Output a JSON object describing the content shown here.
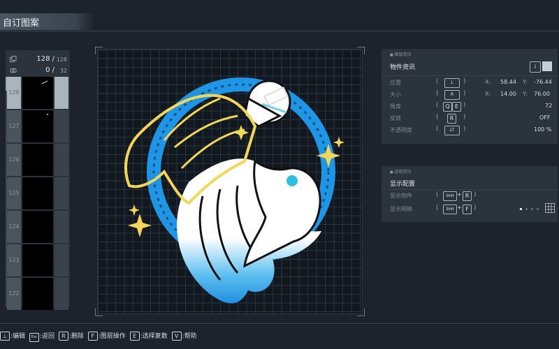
{
  "title": "自订图案",
  "layer_counter": {
    "used": "128 /",
    "max": "128"
  },
  "group_counter": {
    "used": "0 /",
    "max": "32"
  },
  "layers": [
    "128",
    "127",
    "126",
    "125",
    "124",
    "123",
    "122"
  ],
  "object_info": {
    "tag": "图层资讯",
    "title": "物件资讯",
    "position": {
      "label": "位置",
      "x_label": "X:",
      "x": "58.44",
      "y_label": "Y:",
      "y": "-76.44"
    },
    "size": {
      "label": "大小",
      "x_label": "X:",
      "x": "14.00",
      "y_label": "Y:",
      "y": "76.00"
    },
    "angle": {
      "label": "角度",
      "keys": [
        "Q",
        "E"
      ],
      "value": "72"
    },
    "flip": {
      "label": "反转",
      "key": "R",
      "value": "OFF"
    },
    "opacity": {
      "label": "不透明度",
      "value": "100 %"
    }
  },
  "display": {
    "tag": "选项资讯",
    "title": "显示配置",
    "show_objects": {
      "label": "显示物件",
      "key1": "Shift",
      "key2": "R"
    },
    "show_grid": {
      "label": "显示网格",
      "key1": "Shift",
      "key2": "F"
    }
  },
  "hints": [
    {
      "key": "",
      "label": ":编辑"
    },
    {
      "key": "Esc",
      "label": ":返回"
    },
    {
      "key": "R",
      "label": ":删除"
    },
    {
      "key": "F",
      "label": ":图层操作"
    },
    {
      "key": "E",
      "label": ":选择复数"
    },
    {
      "key": "V",
      "label": ":帮助"
    }
  ],
  "colors": {
    "accent_blue": "#2a9be6",
    "wing_yellow": "#f3d55a",
    "panel": "#2b333c"
  }
}
